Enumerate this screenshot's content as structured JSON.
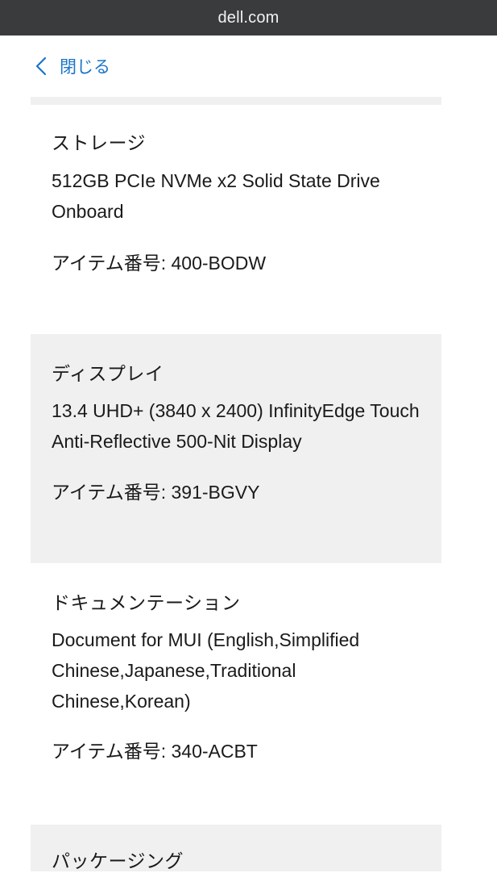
{
  "browser": {
    "url": "dell.com"
  },
  "nav": {
    "close_label": "閉じる"
  },
  "sections": [
    {
      "title": "ストレージ",
      "description": "512GB PCIe NVMe x2 Solid State Drive Onboard",
      "item_number": "アイテム番号: 400-BODW"
    },
    {
      "title": "ディスプレイ",
      "description": "13.4 UHD+ (3840 x 2400) InfinityEdge Touch Anti-Reflective 500-Nit Display",
      "item_number": "アイテム番号: 391-BGVY"
    },
    {
      "title": "ドキュメンテーション",
      "description": "Document for MUI (English,Simplified Chinese,Japanese,Traditional Chinese,Korean)",
      "item_number": "アイテム番号: 340-ACBT"
    },
    {
      "title": "パッケージング"
    }
  ],
  "colors": {
    "url_bar": "#3a3b3d",
    "link": "#1a74c8",
    "shaded_bg": "#f0f0f0"
  }
}
